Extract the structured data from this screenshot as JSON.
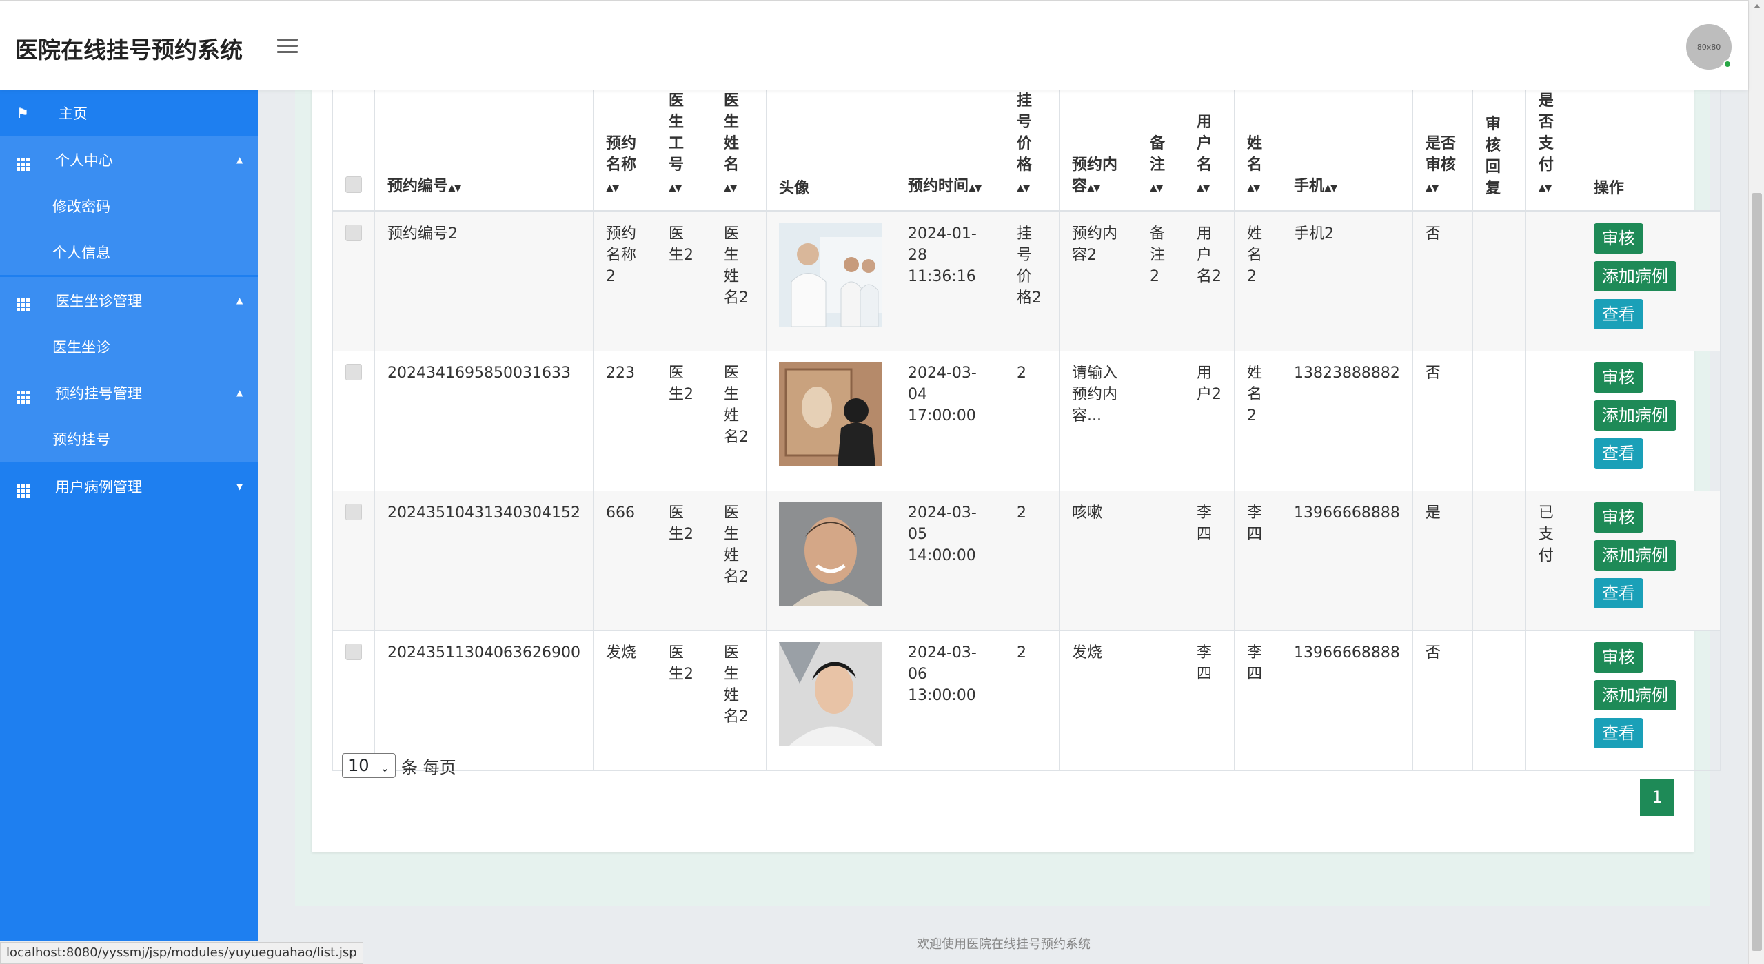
{
  "app": {
    "title": "医院在线挂号预约系统",
    "avatar_label": "80x80"
  },
  "sidebar": {
    "items": [
      {
        "label": "主页",
        "icon": "flag-icon"
      },
      {
        "label": "个人中心",
        "icon": "grid-icon"
      },
      {
        "label": "修改密码"
      },
      {
        "label": "个人信息"
      },
      {
        "label": "医生坐诊管理",
        "icon": "grid-icon"
      },
      {
        "label": "医生坐诊"
      },
      {
        "label": "预约挂号管理",
        "icon": "grid-icon"
      },
      {
        "label": "预约挂号"
      },
      {
        "label": "用户病例管理",
        "icon": "grid-icon"
      }
    ]
  },
  "table": {
    "headers": [
      "预约编号",
      "预约名称",
      "医生工号",
      "医生姓名",
      "头像",
      "预约时间",
      "挂号价格",
      "预约内容",
      "备注",
      "用户名",
      "姓名",
      "手机",
      "是否审核",
      "审核回复",
      "是否支付",
      "操作"
    ],
    "rows": [
      {
        "id": "预约编号2",
        "name": "预约名称2",
        "doc_no": "医生2",
        "doc_name": "医生姓名2",
        "time": "2024-01-28 11:36:16",
        "price": "挂号价格2",
        "content": "预约内容2",
        "note": "备注2",
        "user": "用户名2",
        "real_name": "姓名2",
        "phone": "手机2",
        "reviewed": "否",
        "reply": "",
        "paid": ""
      },
      {
        "id": "2024341695850031633",
        "name": "223",
        "doc_no": "医生2",
        "doc_name": "医生姓名2",
        "time": "2024-03-04 17:00:00",
        "price": "2",
        "content": "请输入预约内容...",
        "note": "",
        "user": "用户2",
        "real_name": "姓名2",
        "phone": "13823888882",
        "reviewed": "否",
        "reply": "",
        "paid": ""
      },
      {
        "id": "20243510431340304152",
        "name": "666",
        "doc_no": "医生2",
        "doc_name": "医生姓名2",
        "time": "2024-03-05 14:00:00",
        "price": "2",
        "content": "咳嗽",
        "note": "",
        "user": "李四",
        "real_name": "李四",
        "phone": "13966668888",
        "reviewed": "是",
        "reply": "",
        "paid": "已支付"
      },
      {
        "id": "20243511304063626900",
        "name": "发烧",
        "doc_no": "医生2",
        "doc_name": "医生姓名2",
        "time": "2024-03-06 13:00:00",
        "price": "2",
        "content": "发烧",
        "note": "",
        "user": "李四",
        "real_name": "李四",
        "phone": "13966668888",
        "reviewed": "否",
        "reply": "",
        "paid": ""
      }
    ],
    "actions": {
      "review": "审核",
      "add_case": "添加病例",
      "view": "查看"
    }
  },
  "pagination": {
    "page_size": "10",
    "per_page_label": "条 每页",
    "current_page": "1"
  },
  "footer": {
    "text": "欢迎使用医院在线挂号预约系统"
  },
  "statusbar": {
    "url": "localhost:8080/yyssmj/jsp/modules/yuyueguahao/list.jsp"
  },
  "colors": {
    "sidebar": "#1e7ff0",
    "button_green": "#1e8a57",
    "button_teal": "#1aa0b8"
  }
}
